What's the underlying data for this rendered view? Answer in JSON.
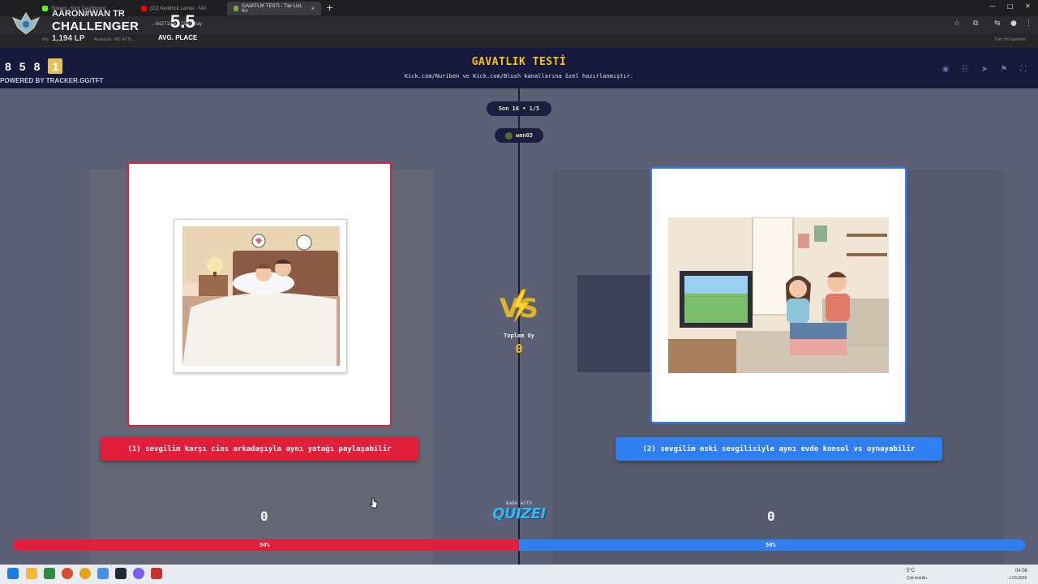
{
  "browser": {
    "tabs": [
      {
        "label": "Stream - Kick Dashboard",
        "color": "#53fc18"
      },
      {
        "label": "(22) Kendrick Lamar - Not",
        "color": "#ff0000"
      },
      {
        "label": "GAVATLIK TESTİ - Tier List, Kır",
        "color": "#7aa63b"
      }
    ],
    "url": "…6d271feb…7867/play",
    "bookmarks": [
      "İnfo",
      "Anasayfa - MC-AT B…"
    ],
    "all_bookmarks": "Tüm Yer İşaretleri"
  },
  "overlay": {
    "player": "AARON#WAN TR",
    "rank": "CHALLENGER",
    "lp": "1,194 LP",
    "avg_value": "5.5",
    "avg_label": "AVG. PLACE",
    "places": [
      "8",
      "5",
      "8",
      "1"
    ],
    "powered": "POWERED BY TRACKER.GG/TFT"
  },
  "app": {
    "title": "GAVATLIK TESTİ",
    "subtitle": "Kick.com/Nuriben ve Kick.com/Blush kanallarına özel hazırlanmıştır.",
    "round": "Son 16 • 1/5",
    "user": "wan03",
    "vs_label": "VS",
    "total_label": "Toplam Oy",
    "total_value": "0",
    "made_with": "made with",
    "brand": "QUIZEI"
  },
  "options": [
    {
      "label": "(1) sevgilim karşı cins arkadaşıyla aynı yatağı paylaşabilir",
      "votes": "0",
      "percent": "50%",
      "color": "#e11f3a"
    },
    {
      "label": "(2) sevgilim eski sevgilisiyle aynı evde konsol vs oynayabilir",
      "votes": "0",
      "percent": "50%",
      "color": "#2f7ff0"
    }
  ],
  "vote_share": [
    0.5,
    0.5
  ],
  "taskbar": {
    "weather": "5°C",
    "weather_desc": "Çok bulutlu",
    "time": "04:58",
    "date": "1.03.2026"
  }
}
